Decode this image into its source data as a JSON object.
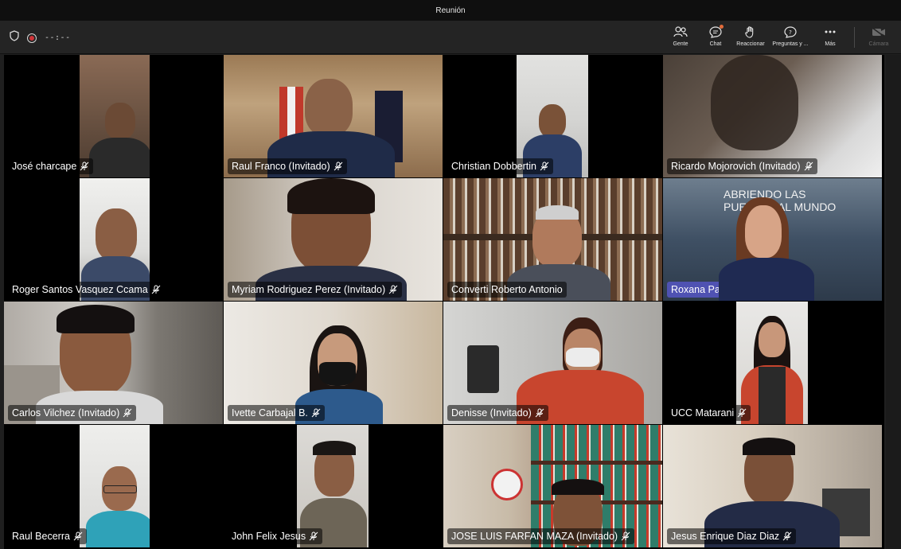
{
  "window": {
    "title": "Reunión"
  },
  "call": {
    "timer": "--:--"
  },
  "toolbar": {
    "people": {
      "label": "Gente",
      "icon": "people-icon"
    },
    "chat": {
      "label": "Chat",
      "icon": "chat-icon"
    },
    "react": {
      "label": "Reaccionar",
      "icon": "raise-hand-icon"
    },
    "qa": {
      "label": "Preguntas y ...",
      "icon": "qa-icon"
    },
    "more": {
      "label": "Más",
      "icon": "more-icon"
    },
    "camera": {
      "label": "Cámara",
      "icon": "camera-off-icon"
    }
  },
  "participants": [
    {
      "name": "José charcape",
      "muted": true,
      "active": false
    },
    {
      "name": "Raul Franco (Invitado)",
      "muted": true,
      "active": false
    },
    {
      "name": "Christian Dobbertin",
      "muted": true,
      "active": false
    },
    {
      "name": "Ricardo Mojorovich (Invitado)",
      "muted": true,
      "active": false
    },
    {
      "name": "Roger Santos Vasquez Ccama",
      "muted": true,
      "active": false
    },
    {
      "name": "Myriam Rodriguez Perez (Invitado)",
      "muted": true,
      "active": false
    },
    {
      "name": "Converti Roberto Antonio",
      "muted": false,
      "active": false
    },
    {
      "name": "Roxana Patricia Jurado Tello",
      "muted": false,
      "active": true
    },
    {
      "name": "Carlos Vilchez (Invitado)",
      "muted": true,
      "active": false
    },
    {
      "name": "Ivette Carbajal B.",
      "muted": true,
      "active": false
    },
    {
      "name": "Denisse (Invitado)",
      "muted": true,
      "active": false
    },
    {
      "name": "UCC Matarani",
      "muted": true,
      "active": false
    },
    {
      "name": "Raul Becerra",
      "muted": true,
      "active": false
    },
    {
      "name": "John Felix Jesus",
      "muted": true,
      "active": false
    },
    {
      "name": "JOSE LUIS FARFAN MAZA (Invitado)",
      "muted": true,
      "active": false
    },
    {
      "name": "Jesus Enrique Diaz Diaz",
      "muted": true,
      "active": false
    }
  ],
  "background_text": {
    "banner": "ABRIENDO LAS PUERTAS AL MUNDO"
  },
  "colors": {
    "active_speaker": "#4f52b2",
    "recording": "#d13438",
    "toolbar_bg": "#242424"
  }
}
